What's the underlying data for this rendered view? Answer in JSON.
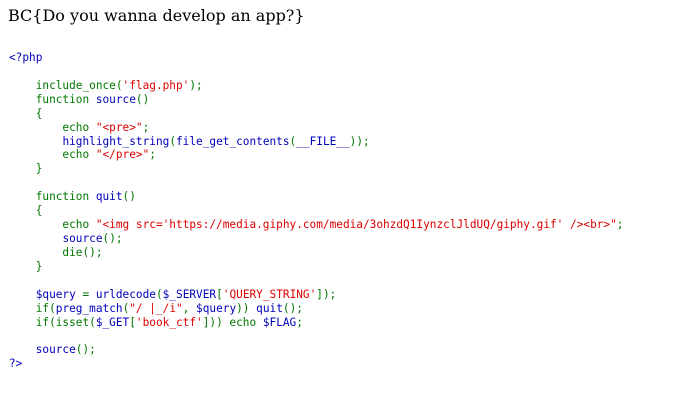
{
  "page": {
    "heading": "BC{Do you wanna develop an app?}"
  },
  "colors": {
    "default": "#0000BB",
    "keyword": "#007700",
    "string": "#DD0000"
  },
  "code": {
    "lines": [
      [
        {
          "t": "<?php",
          "c": "default"
        }
      ],
      [],
      [
        {
          "t": "    include_once(",
          "c": "keyword"
        },
        {
          "t": "'flag.php'",
          "c": "string"
        },
        {
          "t": ");",
          "c": "keyword"
        }
      ],
      [
        {
          "t": "    function ",
          "c": "keyword"
        },
        {
          "t": "source",
          "c": "default"
        },
        {
          "t": "()",
          "c": "keyword"
        }
      ],
      [
        {
          "t": "    {",
          "c": "keyword"
        }
      ],
      [
        {
          "t": "        echo ",
          "c": "keyword"
        },
        {
          "t": "\"<pre>\"",
          "c": "string"
        },
        {
          "t": ";",
          "c": "keyword"
        }
      ],
      [
        {
          "t": "        ",
          "c": "keyword"
        },
        {
          "t": "highlight_string",
          "c": "default"
        },
        {
          "t": "(",
          "c": "keyword"
        },
        {
          "t": "file_get_contents",
          "c": "default"
        },
        {
          "t": "(",
          "c": "keyword"
        },
        {
          "t": "__FILE__",
          "c": "default"
        },
        {
          "t": "));",
          "c": "keyword"
        }
      ],
      [
        {
          "t": "        echo ",
          "c": "keyword"
        },
        {
          "t": "\"</pre>\"",
          "c": "string"
        },
        {
          "t": ";",
          "c": "keyword"
        }
      ],
      [
        {
          "t": "    }",
          "c": "keyword"
        }
      ],
      [],
      [
        {
          "t": "    function ",
          "c": "keyword"
        },
        {
          "t": "quit",
          "c": "default"
        },
        {
          "t": "()",
          "c": "keyword"
        }
      ],
      [
        {
          "t": "    {",
          "c": "keyword"
        }
      ],
      [
        {
          "t": "        echo ",
          "c": "keyword"
        },
        {
          "t": "\"<img src='https://media.giphy.com/media/3ohzdQ1IynzclJldUQ/giphy.gif' /><br>\"",
          "c": "string"
        },
        {
          "t": ";",
          "c": "keyword"
        }
      ],
      [
        {
          "t": "        ",
          "c": "keyword"
        },
        {
          "t": "source",
          "c": "default"
        },
        {
          "t": "();",
          "c": "keyword"
        }
      ],
      [
        {
          "t": "        die",
          "c": "keyword"
        },
        {
          "t": "();",
          "c": "keyword"
        }
      ],
      [
        {
          "t": "    }",
          "c": "keyword"
        }
      ],
      [],
      [
        {
          "t": "    ",
          "c": "keyword"
        },
        {
          "t": "$query ",
          "c": "default"
        },
        {
          "t": "= ",
          "c": "keyword"
        },
        {
          "t": "urldecode",
          "c": "default"
        },
        {
          "t": "(",
          "c": "keyword"
        },
        {
          "t": "$_SERVER",
          "c": "default"
        },
        {
          "t": "[",
          "c": "keyword"
        },
        {
          "t": "'QUERY_STRING'",
          "c": "string"
        },
        {
          "t": "]);",
          "c": "keyword"
        }
      ],
      [
        {
          "t": "    if(",
          "c": "keyword"
        },
        {
          "t": "preg_match",
          "c": "default"
        },
        {
          "t": "(",
          "c": "keyword"
        },
        {
          "t": "\"/ |_/i\"",
          "c": "string"
        },
        {
          "t": ", ",
          "c": "keyword"
        },
        {
          "t": "$query",
          "c": "default"
        },
        {
          "t": ")) ",
          "c": "keyword"
        },
        {
          "t": "quit",
          "c": "default"
        },
        {
          "t": "();",
          "c": "keyword"
        }
      ],
      [
        {
          "t": "    if(isset(",
          "c": "keyword"
        },
        {
          "t": "$_GET",
          "c": "default"
        },
        {
          "t": "[",
          "c": "keyword"
        },
        {
          "t": "'book_ctf'",
          "c": "string"
        },
        {
          "t": "])) echo ",
          "c": "keyword"
        },
        {
          "t": "$FLAG",
          "c": "default"
        },
        {
          "t": ";",
          "c": "keyword"
        }
      ],
      [],
      [
        {
          "t": "    ",
          "c": "keyword"
        },
        {
          "t": "source",
          "c": "default"
        },
        {
          "t": "();",
          "c": "keyword"
        }
      ],
      [
        {
          "t": "?>",
          "c": "default"
        }
      ]
    ]
  }
}
